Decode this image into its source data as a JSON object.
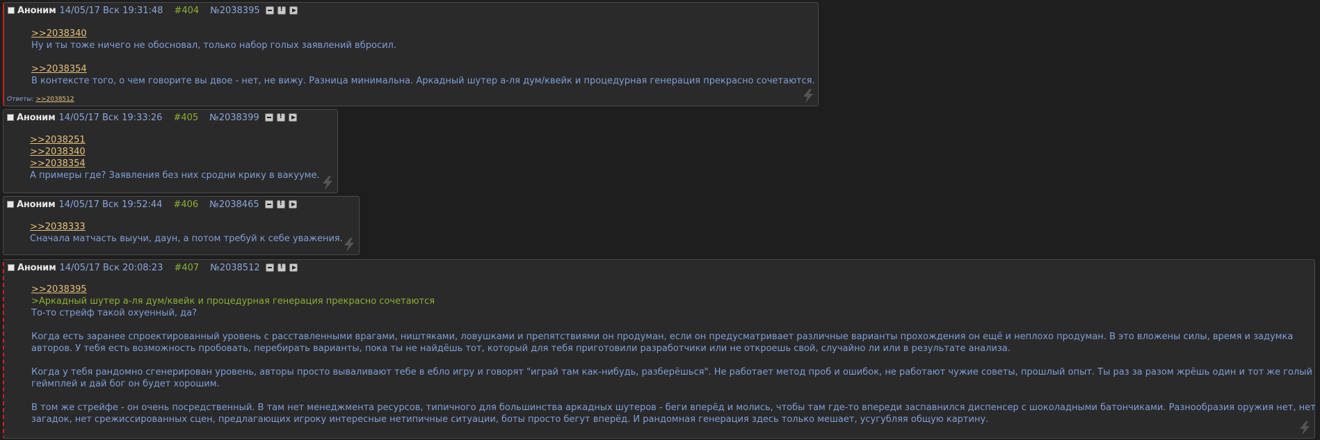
{
  "posts": [
    {
      "name": "Аноним",
      "date": "14/05/17 Вск 19:31:48",
      "num": "#404",
      "no": "№2038395",
      "lines": [
        {
          "type": "link",
          "text": ">>2038340"
        },
        {
          "type": "text",
          "text": "Ну и ты тоже ничего не обосновал, только набор голых заявлений вбросил."
        },
        {
          "type": "gap",
          "text": ""
        },
        {
          "type": "link",
          "text": ">>2038354"
        },
        {
          "type": "text",
          "text": "В контексте того, о чем говорите вы двое - нет, не вижу. Разница минимальна. Аркадный шутер а-ля дум/квейк и процедурная генерация прекрасно сочетаются."
        }
      ],
      "replies_label": "Ответы:",
      "replies": ">>2038512"
    },
    {
      "name": "Аноним",
      "date": "14/05/17 Вск 19:33:26",
      "num": "#405",
      "no": "№2038399",
      "lines": [
        {
          "type": "link",
          "text": ">>2038251"
        },
        {
          "type": "link",
          "text": ">>2038340"
        },
        {
          "type": "link",
          "text": ">>2038354"
        },
        {
          "type": "text",
          "text": "А примеры где? Заявления без них сродни крику в вакууме."
        }
      ]
    },
    {
      "name": "Аноним",
      "date": "14/05/17 Вск 19:52:44",
      "num": "#406",
      "no": "№2038465",
      "lines": [
        {
          "type": "link",
          "text": ">>2038333"
        },
        {
          "type": "text",
          "text": "Сначала матчасть выучи, даун, а потом требуй к себе уважения."
        }
      ]
    },
    {
      "name": "Аноним",
      "date": "14/05/17 Вск 20:08:23",
      "num": "#407",
      "no": "№2038512",
      "lines": [
        {
          "type": "link",
          "text": ">>2038395"
        },
        {
          "type": "quote",
          "text": ">Аркадный шутер а-ля дум/квейк и процедурная генерация прекрасно сочетаются"
        },
        {
          "type": "text",
          "text": "То-то стрейф такой охуенный, да?"
        },
        {
          "type": "gap",
          "text": ""
        },
        {
          "type": "text",
          "text": "Когда есть заранее спроектированный уровень с расставленными врагами, ништяками, ловушками и препятствиями он продуман, если он предусматривает различные варианты прохождения он ещё и неплохо продуман. В это вложены силы, время и задумка"
        },
        {
          "type": "text",
          "text": "авторов. У тебя есть возможность пробовать, перебирать варианты, пока ты не найдёшь тот, который для тебя приготовили разработчики или не откроешь свой, случайно ли или в результате анализа."
        },
        {
          "type": "gap",
          "text": ""
        },
        {
          "type": "text",
          "text": "Когда у тебя рандомно сгенерирован уровень, авторы просто вываливают тебе в ебло игру и говорят \"играй там как-нибудь, разберёшься\". Не работает метод проб и ошибок, не работают чужие советы, прошлый опыт. Ты раз за разом жрёшь один и тот же голый"
        },
        {
          "type": "text",
          "text": "геймплей и дай бог он будет хорошим."
        },
        {
          "type": "gap",
          "text": ""
        },
        {
          "type": "text",
          "text": "В том же стрейфе - он очень посредственный. В там нет менеджмента ресурсов, типичного для большинства аркадных шутеров - беги вперёд и молись, чтобы там где-то впереди заспавнился диспенсер с шоколадными батончиками. Разнообразия оружия нет, нет"
        },
        {
          "type": "text",
          "text": "загадок, нет срежиссированных сцен, предлагающих игроку интересные нетипичные ситуации, боты просто бегут вперёд. И рандомная генерация здесь только мешает, усугубляя общую картину."
        }
      ]
    }
  ]
}
